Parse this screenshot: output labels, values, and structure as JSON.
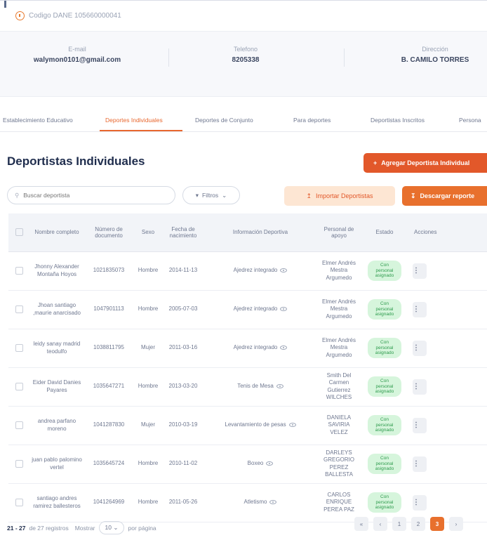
{
  "header": {
    "dane_code": "Codigo DANE 105660000041"
  },
  "contact": {
    "email_label": "E-mail",
    "email_value": "walymon0101@gmail.com",
    "phone_label": "Telefono",
    "phone_value": "8205338",
    "address_label": "Dirección",
    "address_value": "B. CAMILO TORRES"
  },
  "tabs": [
    "Establecimiento Educativo",
    "Deportes Individuales",
    "Deportes de Conjunto",
    "Para deportes",
    "Deportistas Inscritos",
    "Persona"
  ],
  "page_title": "Deportistas Individuales",
  "actions": {
    "add_label": "Agregar Deportista Individual",
    "search_placeholder": "Buscar deportista",
    "filter_label": "Filtros",
    "import_label": "Importar Deportistas",
    "download_label": "Descargar reporte"
  },
  "table": {
    "headers": [
      "Nombre completo",
      "Número de documento",
      "Sexo",
      "Fecha de nacimiento",
      "Información Deportiva",
      "Personal de apoyo",
      "Estado",
      "Acciones"
    ],
    "rows": [
      {
        "name": "Jhonny Alexander Montaña Hoyos",
        "doc": "1021835073",
        "sex": "Hombre",
        "dob": "2014-11-13",
        "sport": "Ajedrez integrado",
        "support": "Elmer Andrés Mestra Argumedo",
        "status": "Con personal asignado"
      },
      {
        "name": "Jhoan santiago ,maurie anarcisado",
        "doc": "1047901113",
        "sex": "Hombre",
        "dob": "2005-07-03",
        "sport": "Ajedrez integrado",
        "support": "Elmer Andrés Mestra Argumedo",
        "status": "Con personal asignado"
      },
      {
        "name": "leidy sanay madrid teodulfo",
        "doc": "1038811795",
        "sex": "Mujer",
        "dob": "2011-03-16",
        "sport": "Ajedrez integrado",
        "support": "Elmer Andrés Mestra Argumedo",
        "status": "Con personal asignado"
      },
      {
        "name": "Eider David Danies Payares",
        "doc": "1035647271",
        "sex": "Hombre",
        "dob": "2013-03-20",
        "sport": "Tenis de Mesa",
        "support": "Smith Del Carmen Gutierrez WILCHES",
        "status": "Con personal asignado"
      },
      {
        "name": "andrea parfano moreno",
        "doc": "1041287830",
        "sex": "Mujer",
        "dob": "2010-03-19",
        "sport": "Levantamiento de pesas",
        "support": "DANIELA SAVIRIA VELEZ",
        "status": "Con personal asignado"
      },
      {
        "name": "juan pablo palomino vertel",
        "doc": "1035645724",
        "sex": "Hombre",
        "dob": "2010-11-02",
        "sport": "Boxeo",
        "support": "DARLEYS GREGORIO PEREZ BALLESTA",
        "status": "Con personal asignado"
      },
      {
        "name": "santiago andres ramirez ballesteros",
        "doc": "1041264969",
        "sex": "Hombre",
        "dob": "2011-05-26",
        "sport": "Atletismo",
        "support": "CARLOS ENRIQUE PEREA PAZ",
        "status": "Con personal asignado"
      }
    ],
    "action_glyph": "⋮"
  },
  "footer": {
    "range": "21 - 27",
    "total_text": "de 27 registros",
    "show_label": "Mostrar",
    "per_page_value": "10",
    "per_page_suffix": "por página"
  },
  "pagination": [
    "«",
    "‹",
    "1",
    "2",
    "3",
    "›"
  ],
  "colors": {
    "accent": "#e2582a",
    "badge_bg": "#d6f5dc",
    "badge_text": "#2e9b4d"
  }
}
